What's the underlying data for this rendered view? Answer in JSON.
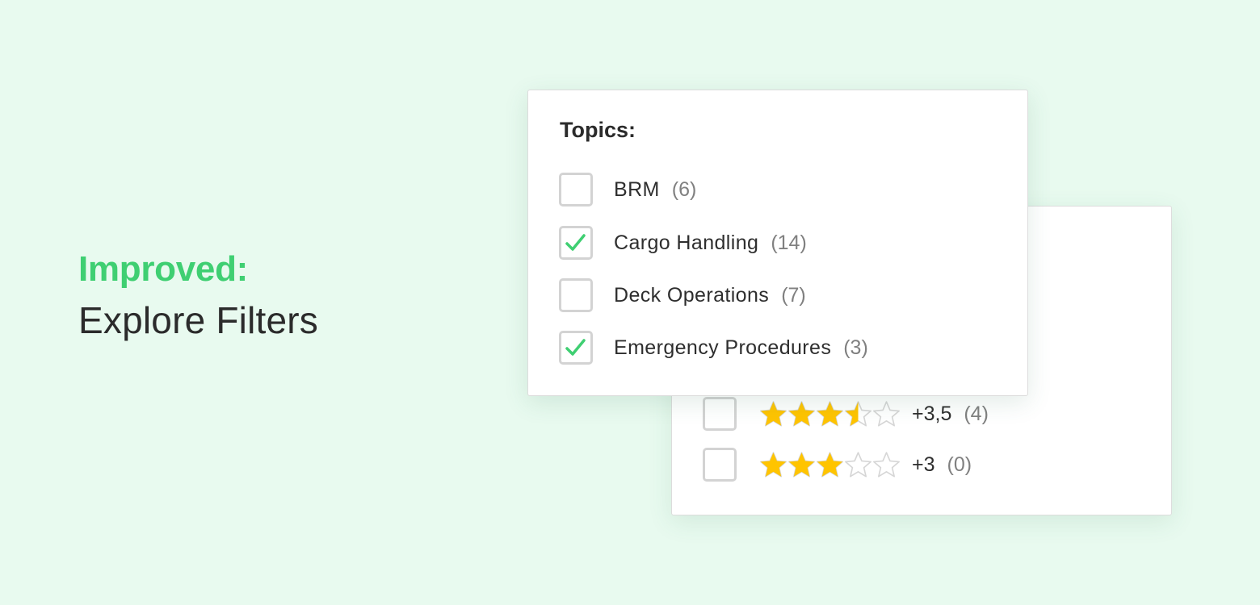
{
  "headline": {
    "accent": "Improved:",
    "title": "Explore Filters"
  },
  "colors": {
    "accent_green": "#3fcf72",
    "star_yellow": "#ffc400",
    "star_empty": "#d6d6d6",
    "background": "#e8faef"
  },
  "topics_card": {
    "title": "Topics:",
    "items": [
      {
        "label": "BRM",
        "count": "(6)",
        "checked": false
      },
      {
        "label": "Cargo Handling",
        "count": "(14)",
        "checked": true
      },
      {
        "label": "Deck Operations",
        "count": "(7)",
        "checked": false
      },
      {
        "label": "Emergency Procedures",
        "count": "(3)",
        "checked": true
      }
    ]
  },
  "rating_card": {
    "items": [
      {
        "rating": 3.5,
        "label": "+3,5",
        "count": "(4)",
        "checked": false
      },
      {
        "rating": 3,
        "label": "+3",
        "count": "(0)",
        "checked": false
      }
    ]
  }
}
